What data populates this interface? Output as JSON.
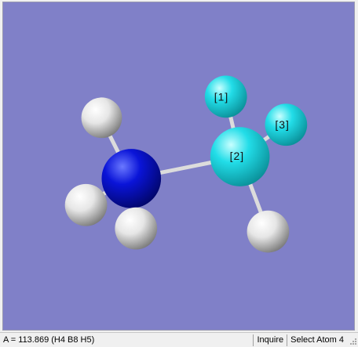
{
  "viewer": {
    "background_color": "#8080c8",
    "atom_labels": [
      "[1]",
      "[2]",
      "[3]"
    ],
    "colors": {
      "nitrogen": "#0a14d8",
      "boron": "#22dde8",
      "hydrogen": "#f2f2f2",
      "bond": "#d8d8d8"
    }
  },
  "statusbar": {
    "message": "A = 113.869 (H4 B8 H5)",
    "mode": "Inquire",
    "hint": "Select Atom 4"
  }
}
